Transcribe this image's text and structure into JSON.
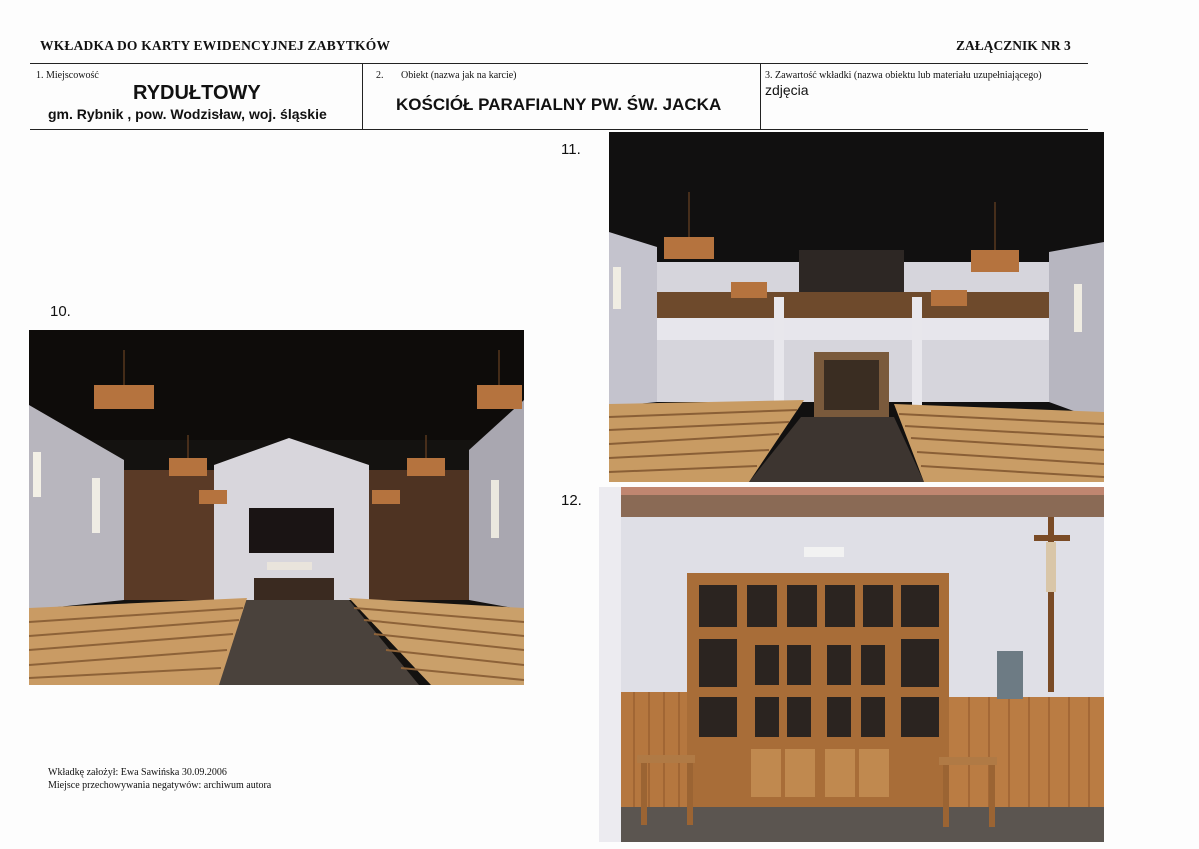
{
  "header": {
    "title": "WKŁADKA DO KARTY EWIDENCYJNEJ ZABYTKÓW",
    "attachment": "ZAŁĄCZNIK NR 3"
  },
  "fields": {
    "locality_label": "1. Miejscowość",
    "locality_value": "RYDUŁTOWY",
    "locality_sub": "gm. Rybnik  , pow. Wodzisław,  woj. śląskie",
    "object_label_num": "2.",
    "object_label": "Obiekt (nazwa jak na karcie)",
    "object_value": "KOŚCIÓŁ PARAFIALNY  PW. ŚW. JACKA",
    "content_label": "3. Zawartość wkładki (nazwa obiektu lub materiału uzupełniającego)",
    "content_value": "zdjęcia"
  },
  "photos": [
    {
      "number": "10.",
      "subject": "church-interior-toward-altar"
    },
    {
      "number": "11.",
      "subject": "church-interior-toward-choir-loft"
    },
    {
      "number": "12.",
      "subject": "church-entrance-doors-with-crucifix"
    }
  ],
  "footer": {
    "author": "Wkładkę założył: Ewa Sawińska  30.09.2006",
    "negatives": "Miejsce przechowywania negatywów: archiwum autora"
  }
}
